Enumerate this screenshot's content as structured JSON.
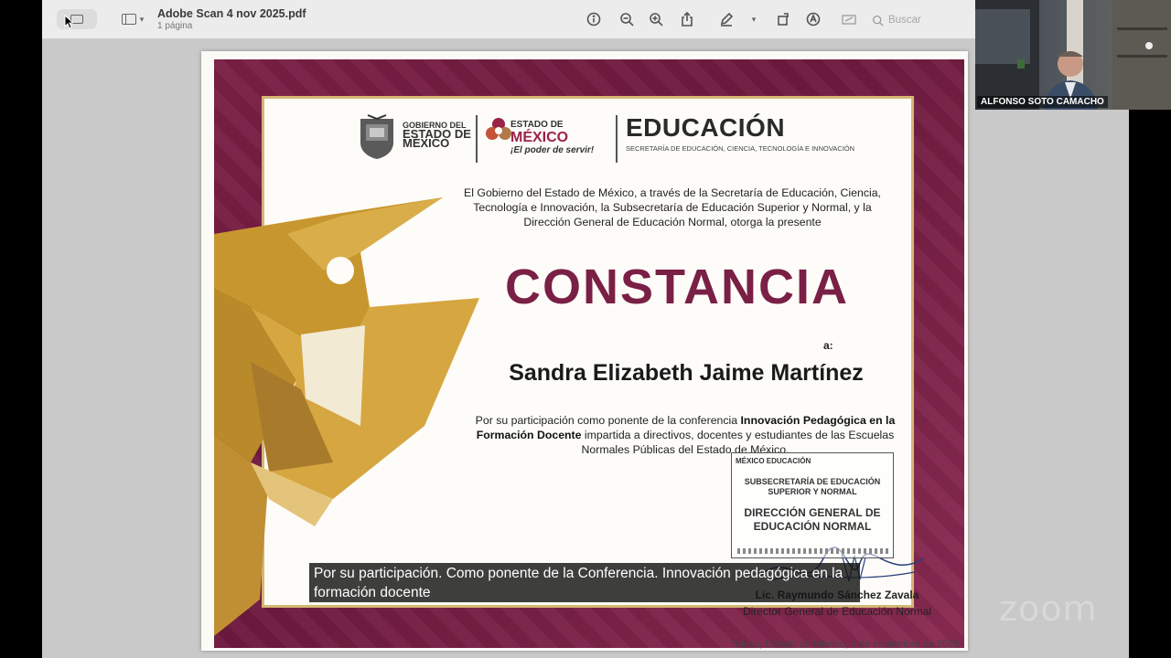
{
  "toolbar": {
    "document_title": "Adobe Scan 4 nov 2025.pdf",
    "page_count": "1 página",
    "search_placeholder": "Buscar",
    "icons": [
      "view-mode-icon",
      "sidebar-icon",
      "info-icon",
      "zoom-out-icon",
      "zoom-in-icon",
      "share-icon",
      "markup-pen-icon",
      "rotate-icon",
      "annotate-icon",
      "form-fill-icon",
      "search-icon"
    ]
  },
  "certificate": {
    "logo_gob_line1": "GOBIERNO DEL",
    "logo_gob_line2": "ESTADO DE",
    "logo_gob_line3": "MÉXICO",
    "logo_edomex_line1": "ESTADO DE",
    "logo_edomex_line2": "MÉXICO",
    "logo_edomex_slogan": "¡El poder de servir!",
    "education_title": "EDUCACIÓN",
    "education_subtitle": "SECRETARÍA DE EDUCACIÓN, CIENCIA, TECNOLOGÍA E INNOVACIÓN",
    "intro_text": "El Gobierno del Estado de México, a través de la Secretaría de Educación, Ciencia, Tecnología e Innovación, la Subsecretaría de Educación Superior y Normal, y la Dirección General de Educación Normal, otorga la presente",
    "heading": "CONSTANCIA",
    "to_label": "a:",
    "recipient": "Sandra Elizabeth Jaime Martínez",
    "reason_part1": "Por su participación como ponente de la conferencia",
    "reason_bold": "Innovación Pedagógica en la Formación Docente",
    "reason_part2": "impartida a directivos, docentes y estudiantes de las Escuelas Normales Públicas del Estado de México.",
    "stamp_header": "MÉXICO EDUCACIÓN",
    "stamp_sub": "SUBSECRETARÍA DE EDUCACIÓN SUPERIOR Y NORMAL",
    "stamp_main": "DIRECCIÓN GENERAL DE EDUCACIÓN NORMAL",
    "signer_name": "Lic. Raymundo Sánchez Zavala",
    "signer_title": "Director General de Educación Normal",
    "place_date": "Toluca, Estado de México, 4 de noviembre de 2025."
  },
  "caption": {
    "text": "Por su participación. Como ponente de la Conferencia. Innovación pedagógica en la formación docente"
  },
  "video": {
    "participant_name": "ALFONSO SOTO CAMACHO"
  },
  "branding": {
    "app_logo": "zoom"
  },
  "colors": {
    "maroon": "#7a1f45",
    "gold": "#d4b774",
    "caption_bg": "#141414"
  }
}
